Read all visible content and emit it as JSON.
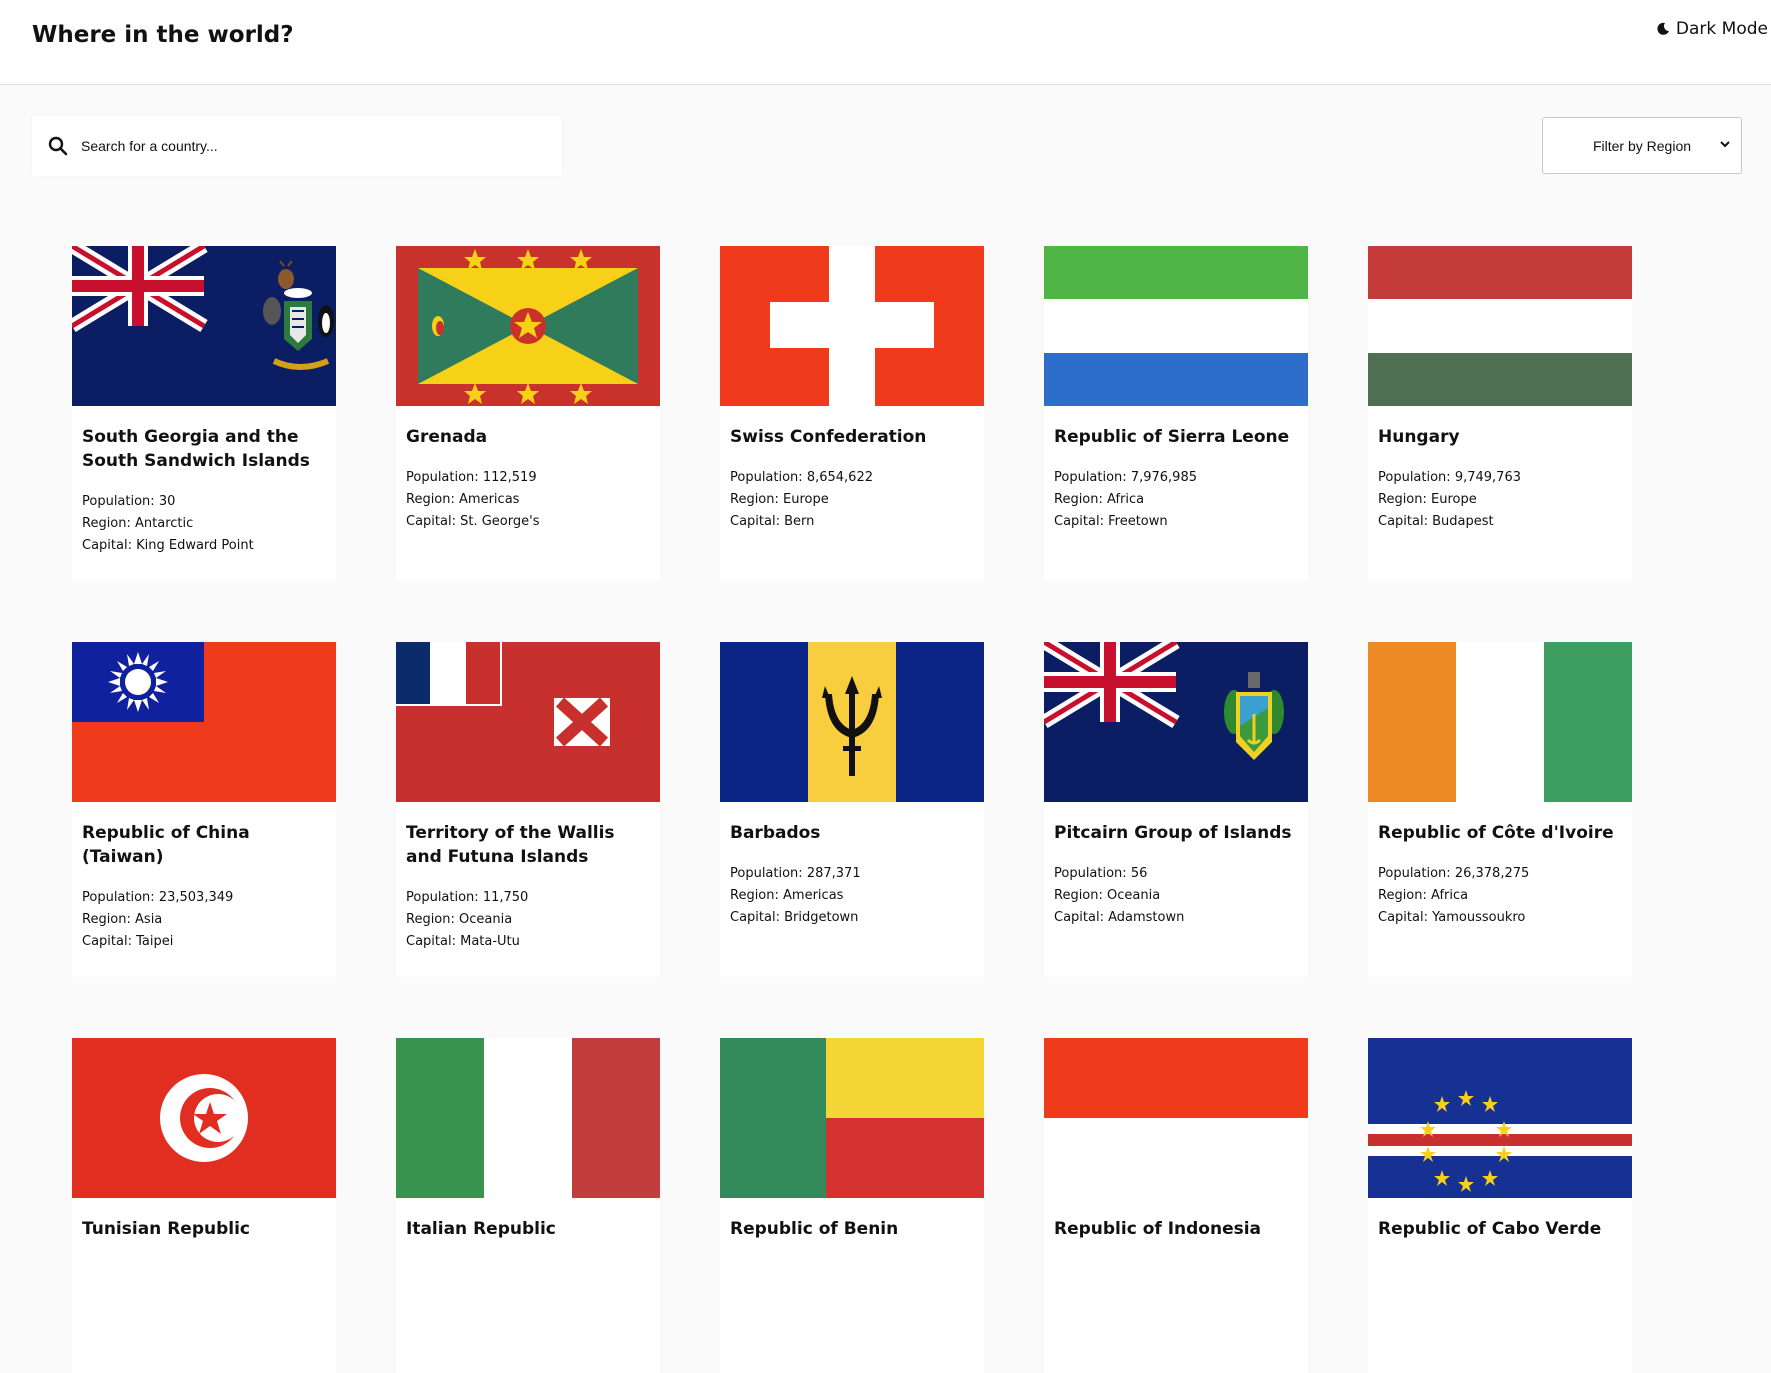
{
  "header": {
    "title": "Where in the world?",
    "dark_mode_label": "Dark Mode"
  },
  "search": {
    "placeholder": "Search for a country..."
  },
  "filter": {
    "label": "Filter by Region"
  },
  "labels": {
    "population": "Population:",
    "region": "Region:",
    "capital": "Capital:"
  },
  "countries": [
    {
      "name": "South Georgia and the South Sandwich Islands",
      "population": "30",
      "region": "Antarctic",
      "capital": "King Edward Point",
      "flag": "sgs-flag"
    },
    {
      "name": "Grenada",
      "population": "112,519",
      "region": "Americas",
      "capital": "St. George's",
      "flag": "grenada-flag"
    },
    {
      "name": "Swiss Confederation",
      "population": "8,654,622",
      "region": "Europe",
      "capital": "Bern",
      "flag": "switzerland-flag"
    },
    {
      "name": "Republic of Sierra Leone",
      "population": "7,976,985",
      "region": "Africa",
      "capital": "Freetown",
      "flag": "sierra-leone-flag"
    },
    {
      "name": "Hungary",
      "population": "9,749,763",
      "region": "Europe",
      "capital": "Budapest",
      "flag": "hungary-flag"
    },
    {
      "name": "Republic of China (Taiwan)",
      "population": "23,503,349",
      "region": "Asia",
      "capital": "Taipei",
      "flag": "taiwan-flag"
    },
    {
      "name": "Territory of the Wallis and Futuna Islands",
      "population": "11,750",
      "region": "Oceania",
      "capital": "Mata-Utu",
      "flag": "wallis-futuna-flag"
    },
    {
      "name": "Barbados",
      "population": "287,371",
      "region": "Americas",
      "capital": "Bridgetown",
      "flag": "barbados-flag"
    },
    {
      "name": "Pitcairn Group of Islands",
      "population": "56",
      "region": "Oceania",
      "capital": "Adamstown",
      "flag": "pitcairn-flag"
    },
    {
      "name": "Republic of Côte d'Ivoire",
      "population": "26,378,275",
      "region": "Africa",
      "capital": "Yamoussoukro",
      "flag": "ivory-coast-flag"
    },
    {
      "name": "Tunisian Republic",
      "population": "",
      "region": "",
      "capital": "",
      "flag": "tunisia-flag"
    },
    {
      "name": "Italian Republic",
      "population": "",
      "region": "",
      "capital": "",
      "flag": "italy-flag"
    },
    {
      "name": "Republic of Benin",
      "population": "",
      "region": "",
      "capital": "",
      "flag": "benin-flag"
    },
    {
      "name": "Republic of Indonesia",
      "population": "",
      "region": "",
      "capital": "",
      "flag": "indonesia-flag"
    },
    {
      "name": "Republic of Cabo Verde",
      "population": "",
      "region": "",
      "capital": "",
      "flag": "cabo-verde-flag"
    }
  ]
}
